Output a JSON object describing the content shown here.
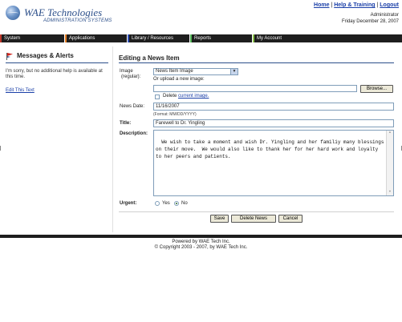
{
  "header": {
    "logo_title": "WAE Technologies",
    "logo_subtitle": "ADMINISTRATION SYSTEMS",
    "links": {
      "home": "Home",
      "help": "Help & Training",
      "logout": "Logout",
      "separator": "|"
    },
    "user_role": "Administrator",
    "date": "Friday December 28, 2007"
  },
  "nav": {
    "items": [
      {
        "label": "System",
        "color": "#c0392b"
      },
      {
        "label": "Applications",
        "color": "#e67e22"
      },
      {
        "label": "Library / Resources",
        "color": "#2e4fb7"
      },
      {
        "label": "Reports",
        "color": "#4caf50"
      },
      {
        "label": "My Account",
        "color": "#8bc34a"
      }
    ]
  },
  "sidebar": {
    "title": "Messages & Alerts",
    "message": "I'm sorry, but no additional help is available at this time.",
    "edit_link": "Edit This Text"
  },
  "form": {
    "title": "Editing a News Item",
    "image_label": "Image",
    "image_sublabel": "(regular):",
    "image_select_value": "News Item Image",
    "upload_hint": "Or upload a new image:",
    "browse_label": "Browse...",
    "delete_label": "Delete",
    "current_image_link": "current image.",
    "news_date_label": "News Date:",
    "news_date_value": "11/16/2007",
    "date_format_hint": "(Format: MM/DD/YYYY)",
    "title_label": "Title:",
    "title_value": "Farewell to Dr. Yingling",
    "description_label": "Description:",
    "description_value": "We wish to take a moment and wish Dr. Yingling and her familiy many blessings on their move.  We would also like to thank her for her hard work and loyalty to her peers and patients.",
    "urgent_label": "Urgent:",
    "urgent_options": [
      "Yes",
      "No"
    ],
    "urgent_selected": "No",
    "save_label": "Save",
    "delete_news_label": "Delete News",
    "cancel_label": "Cancel"
  },
  "footer": {
    "powered_by": "Powered by WAE Tech Inc.",
    "copyright": "© Copyright 2003 - 2007, by WAE Tech Inc."
  }
}
